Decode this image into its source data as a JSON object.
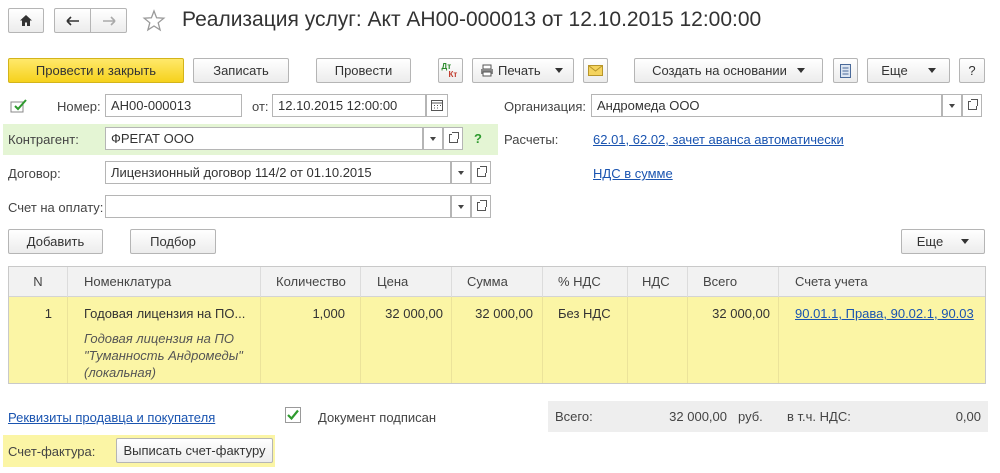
{
  "window": {
    "title": "Реализация услуг: Акт АН00-000013 от 12.10.2015 12:00:00"
  },
  "toolbar": {
    "post_close": "Провести и закрыть",
    "save": "Записать",
    "post": "Провести",
    "print": "Печать",
    "create_based": "Создать на основании",
    "more": "Еще",
    "help": "?",
    "dtkt_top": "Дт",
    "dtkt_bottom": "Кт"
  },
  "form": {
    "number_label": "Номер:",
    "number_value": "АН00-000013",
    "date_label": "от:",
    "date_value": "12.10.2015 12:00:00",
    "org_label": "Организация:",
    "org_value": "Андромеда ООО",
    "counterparty_label": "Контрагент:",
    "counterparty_value": "ФРЕГАТ ООО",
    "help_q": "?",
    "settlements_label": "Расчеты:",
    "settlements_link": "62.01, 62.02, зачет аванса автоматически",
    "contract_label": "Договор:",
    "contract_value": "Лицензионный договор 114/2 от 01.10.2015",
    "vat_link": "НДС в сумме",
    "invoice_label": "Счет на оплату:",
    "invoice_value": ""
  },
  "table_toolbar": {
    "add": "Добавить",
    "select": "Подбор",
    "more": "Еще"
  },
  "table": {
    "columns": [
      "N",
      "Номенклатура",
      "Количество",
      "Цена",
      "Сумма",
      "% НДС",
      "НДС",
      "Всего",
      "Счета учета"
    ],
    "rows": [
      {
        "n": "1",
        "item": "Годовая лицензия на ПО...",
        "content_line1": "Годовая лицензия на ПО",
        "content_line2": "\"Туманность Андромеды\"",
        "content_line3": "(локальная)",
        "qty": "1,000",
        "price": "32 000,00",
        "sum": "32 000,00",
        "vat_rate": "Без НДС",
        "vat": "",
        "total": "32 000,00",
        "accounts": "90.01.1, Права, 90.02.1, 90.03"
      }
    ]
  },
  "footer": {
    "requisites_link": "Реквизиты продавца и покупателя",
    "signed_label": "Документ подписан",
    "signed": true,
    "total_label": "Всего:",
    "total_value": "32 000,00",
    "currency": "руб.",
    "vat_incl_label": "в т.ч. НДС:",
    "vat_value": "0,00",
    "invoice_label": "Счет-фактура:",
    "invoice_button": "Выписать счет-фактуру"
  },
  "colors": {
    "accent_yellow": "#f6d21c",
    "row_highlight": "#fbf5a5",
    "link_blue": "#1a54b0",
    "counterparty_bg": "#e4f5d4"
  }
}
